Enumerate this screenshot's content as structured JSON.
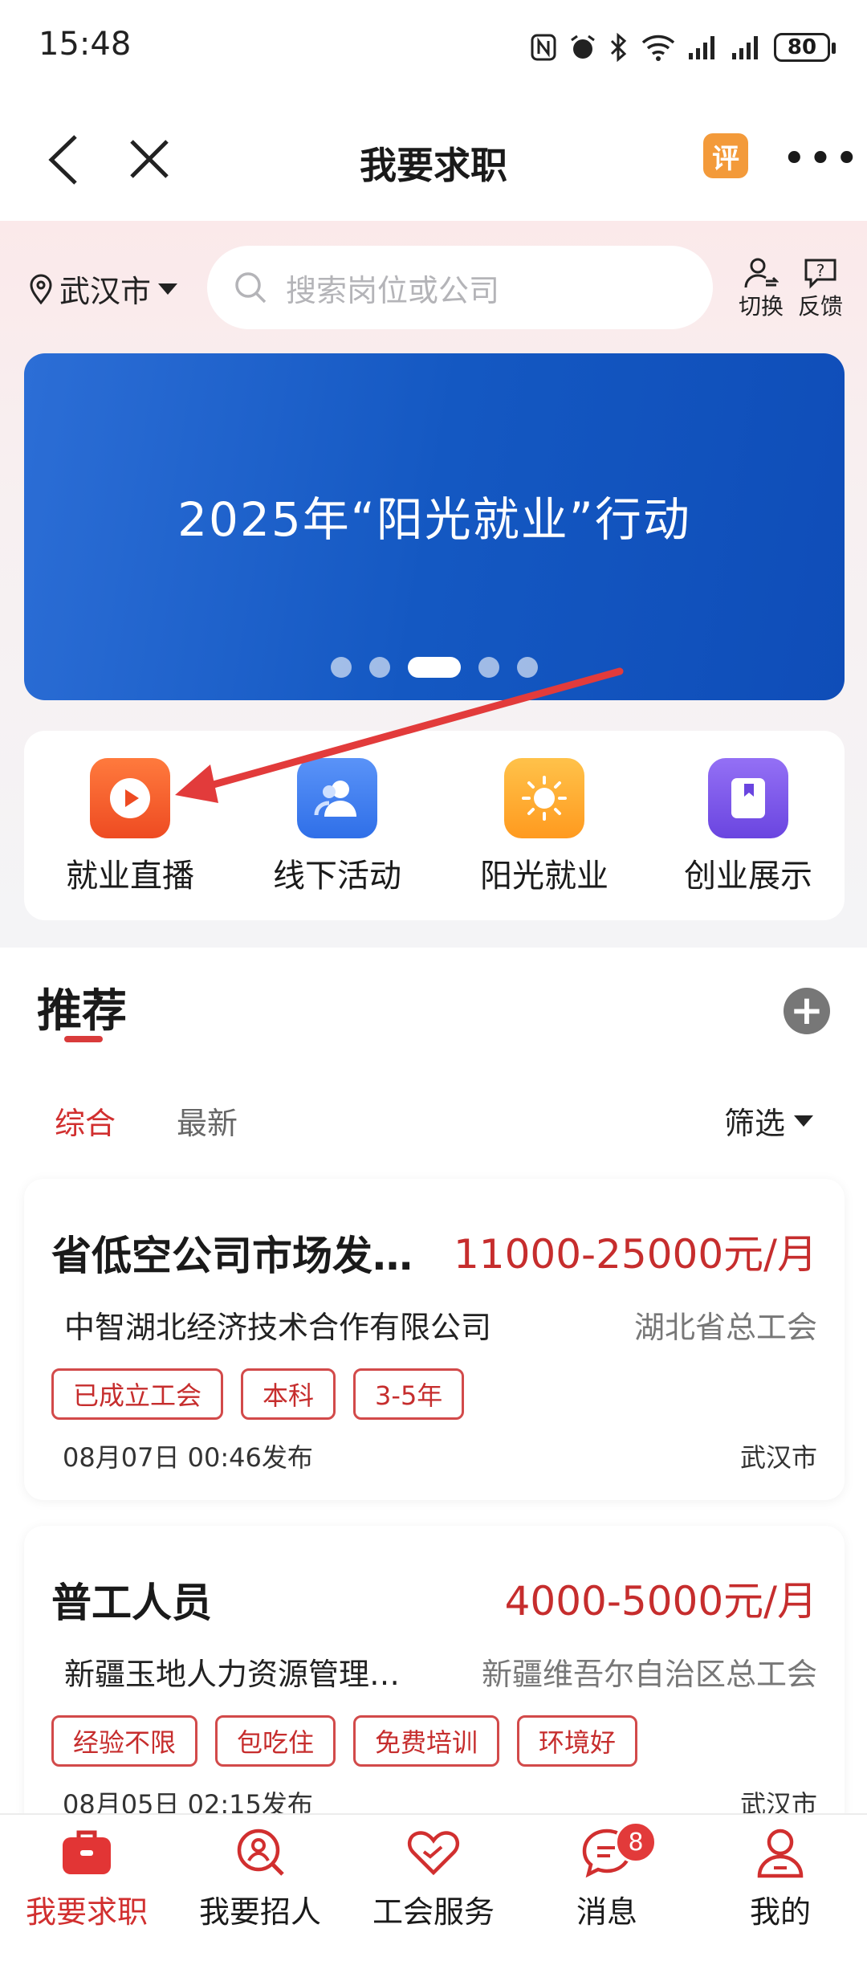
{
  "status_bar": {
    "time": "15:48",
    "battery": "80"
  },
  "nav": {
    "title": "我要求职",
    "rating_icon_text": "评"
  },
  "top": {
    "city": "武汉市",
    "search_placeholder": "搜索岗位或公司",
    "switch_label": "切换",
    "feedback_label": "反馈"
  },
  "banner": {
    "text": "2025年“阳光就业”行动",
    "dots_total": 5,
    "active_dot": 3
  },
  "quick_entries": [
    {
      "label": "就业直播",
      "icon": "play-icon",
      "color": "#f25a2a"
    },
    {
      "label": "线下活动",
      "icon": "people-icon",
      "color": "#3d7df0"
    },
    {
      "label": "阳光就业",
      "icon": "sun-icon",
      "color": "#ffab2e"
    },
    {
      "label": "创业展示",
      "icon": "book-icon",
      "color": "#7b55e8"
    }
  ],
  "recommend": {
    "title": "推荐",
    "tabs": [
      {
        "label": "综合",
        "active": true
      },
      {
        "label": "最新",
        "active": false
      }
    ],
    "filter_label": "筛选"
  },
  "jobs": [
    {
      "title": "省低空公司市场发…",
      "salary": "11000-25000元/月",
      "company": "中智湖北经济技术合作有限公司",
      "union": "湖北省总工会",
      "tags": [
        "已成立工会",
        "本科",
        "3-5年"
      ],
      "date": "08月07日 00:46发布",
      "city": "武汉市"
    },
    {
      "title": "普工人员",
      "salary": "4000-5000元/月",
      "company": "新疆玉地人力资源管理…",
      "union": "新疆维吾尔自治区总工会",
      "tags": [
        "经验不限",
        "包吃住",
        "免费培训",
        "环境好"
      ],
      "date": "08月05日 02:15发布",
      "city": "武汉市"
    }
  ],
  "bottom_nav": [
    {
      "label": "我要求职",
      "icon": "briefcase-icon",
      "active": true
    },
    {
      "label": "我要招人",
      "icon": "search-person-icon",
      "active": false
    },
    {
      "label": "工会服务",
      "icon": "heart-icon",
      "active": false
    },
    {
      "label": "消息",
      "icon": "message-icon",
      "active": false,
      "badge": "8"
    },
    {
      "label": "我的",
      "icon": "user-icon",
      "active": false
    }
  ],
  "colors": {
    "accent": "#d12f2f",
    "salary": "#c62d2d",
    "banner": "#1458c2"
  }
}
